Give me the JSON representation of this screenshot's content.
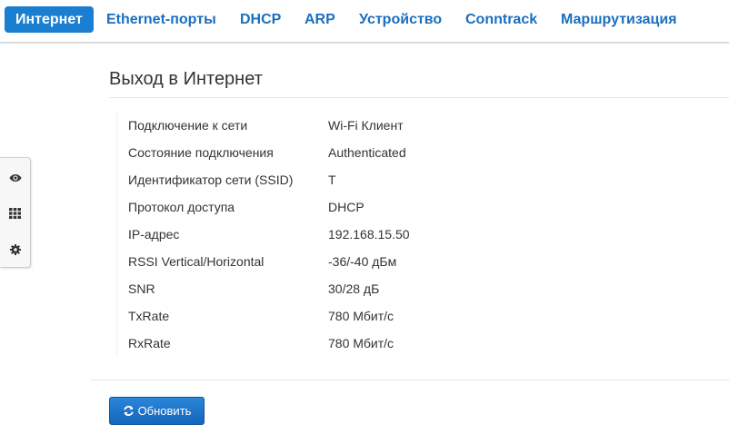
{
  "tabs": [
    {
      "label": "Интернет",
      "active": true
    },
    {
      "label": "Ethernet-порты",
      "active": false
    },
    {
      "label": "DHCP",
      "active": false
    },
    {
      "label": "ARP",
      "active": false
    },
    {
      "label": "Устройство",
      "active": false
    },
    {
      "label": "Conntrack",
      "active": false
    },
    {
      "label": "Маршрутизация",
      "active": false
    }
  ],
  "sidebar": {
    "icons": [
      "eye-icon",
      "grid-icon",
      "gear-icon"
    ]
  },
  "section": {
    "title": "Выход в Интернет"
  },
  "info": [
    {
      "label": "Подключение к сети",
      "value": "Wi-Fi Клиент"
    },
    {
      "label": "Состояние подключения",
      "value": "Authenticated"
    },
    {
      "label": "Идентификатор сети (SSID)",
      "value": "T"
    },
    {
      "label": "Протокол доступа",
      "value": "DHCP"
    },
    {
      "label": "IP-адрес",
      "value": "192.168.15.50"
    },
    {
      "label": "RSSI Vertical/Horizontal",
      "value": "-36/-40 дБм"
    },
    {
      "label": "SNR",
      "value": "30/28 дБ"
    },
    {
      "label": "TxRate",
      "value": "780 Мбит/с"
    },
    {
      "label": "RxRate",
      "value": "780 Мбит/с"
    }
  ],
  "actions": {
    "refresh_label": "Обновить",
    "refresh_icon": "refresh-icon"
  },
  "colors": {
    "accent": "#1a7fd0",
    "tab_text": "#1a6fc0",
    "button": "#1a6fc8"
  }
}
